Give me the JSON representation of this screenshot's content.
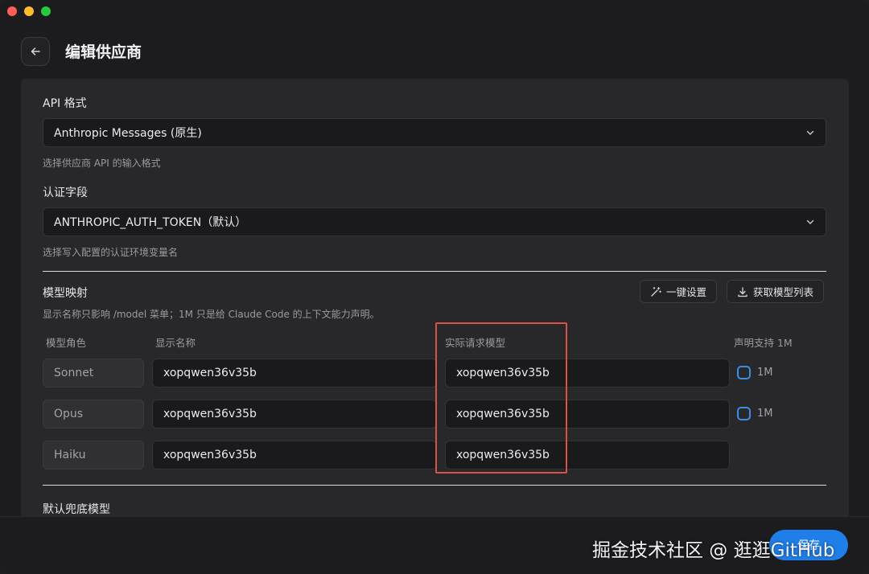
{
  "header": {
    "title": "编辑供应商"
  },
  "api_format": {
    "label": "API 格式",
    "value": "Anthropic Messages (原生)",
    "hint": "选择供应商 API 的输入格式"
  },
  "auth_field": {
    "label": "认证字段",
    "value": "ANTHROPIC_AUTH_TOKEN（默认）",
    "hint": "选择写入配置的认证环境变量名"
  },
  "model_mapping": {
    "title": "模型映射",
    "hint": "显示名称只影响 /model 菜单；1M 只是给 Claude Code 的上下文能力声明。",
    "one_click_label": "一键设置",
    "fetch_models_label": "获取模型列表",
    "columns": {
      "role": "模型角色",
      "display_name": "显示名称",
      "actual_model": "实际请求模型",
      "declare_1m": "声明支持 1M"
    },
    "rows": [
      {
        "role": "Sonnet",
        "display_name": "xopqwen36v35b",
        "actual_model": "xopqwen36v35b",
        "check_label": "1M"
      },
      {
        "role": "Opus",
        "display_name": "xopqwen36v35b",
        "actual_model": "xopqwen36v35b",
        "check_label": "1M"
      },
      {
        "role": "Haiku",
        "display_name": "xopqwen36v35b",
        "actual_model": "xopqwen36v35b"
      }
    ]
  },
  "fallback": {
    "label": "默认兜底模型"
  },
  "footer": {
    "save_label": "保存",
    "watermark": "掘金技术社区 @ 逛逛GitHub"
  },
  "colors": {
    "accent": "#1f7ee8",
    "highlight": "#d9524a",
    "background": "#1c1c1e",
    "panel": "#28282b"
  }
}
